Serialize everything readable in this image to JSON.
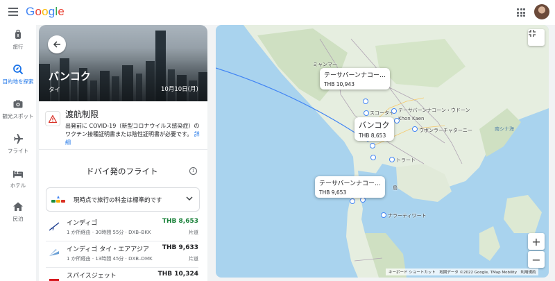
{
  "app": {
    "logo_letters": [
      "G",
      "o",
      "o",
      "g",
      "l",
      "e"
    ],
    "logo_colors": [
      "#4285f4",
      "#ea4335",
      "#fbbc05",
      "#4285f4",
      "#34a853",
      "#ea4335"
    ]
  },
  "rail": {
    "items": [
      {
        "label": "旅行",
        "icon": "luggage-icon"
      },
      {
        "label": "目的地を探索",
        "icon": "explore-icon"
      },
      {
        "label": "観光スポット",
        "icon": "camera-icon"
      },
      {
        "label": "フライト",
        "icon": "plane-icon"
      },
      {
        "label": "ホテル",
        "icon": "bed-icon"
      },
      {
        "label": "民泊",
        "icon": "house-icon"
      }
    ],
    "active_index": 1
  },
  "destination": {
    "city": "バンコク",
    "country": "タイ",
    "date": "10月10日(月)"
  },
  "restrictions": {
    "title": "渡航制限",
    "body": "出発前に COVID-19（新型コロナウイルス感染症）のワクチン接種証明書または陰性証明書が必要です。",
    "link": "詳細"
  },
  "flights_section": {
    "title": "ドバイ発のフライト",
    "price_note": "現時点で旅行の料金は標準的です",
    "flights": [
      {
        "airline": "インディゴ",
        "detail": "1 か所経由 · 30時間 55分 · DXB–BKK",
        "price": "THB 8,653",
        "type": "片道",
        "price_color": "#188038"
      },
      {
        "airline": "インディゴ タイ・エアアジア",
        "detail": "1 か所経由 · 13時間 45分 · DXB–DMK",
        "price": "THB 9,633",
        "type": "片道",
        "price_color": "#202124"
      },
      {
        "airline": "スパイスジェット",
        "detail": "",
        "price": "THB 10,324",
        "type": "",
        "price_color": "#202124"
      }
    ]
  },
  "map": {
    "bubbles": [
      {
        "name": "テーサバーンナコー…",
        "price": "THB 10,943"
      },
      {
        "name": "バンコク",
        "price": "THB 8,653"
      },
      {
        "name": "テーサバーンナコー…",
        "price": "THB 9,653"
      }
    ],
    "labels": {
      "myanmar": "ミャンマー",
      "sukhothai": "スコータイ",
      "tesaban": "テーサバーンナコーン・ウドーン",
      "khon_kaen": "Khon Kaen",
      "ratchathani": "ウボンラーチャターニー",
      "south_china_sea": "南シナ海",
      "trat": "トラート",
      "island": "島",
      "narathiwat": "ナラーティワート"
    },
    "footer": "キーボード ショートカット　地図データ ©2022 Google, TMap Mobility　利用規約",
    "zoom_in": "+",
    "zoom_out": "−"
  }
}
